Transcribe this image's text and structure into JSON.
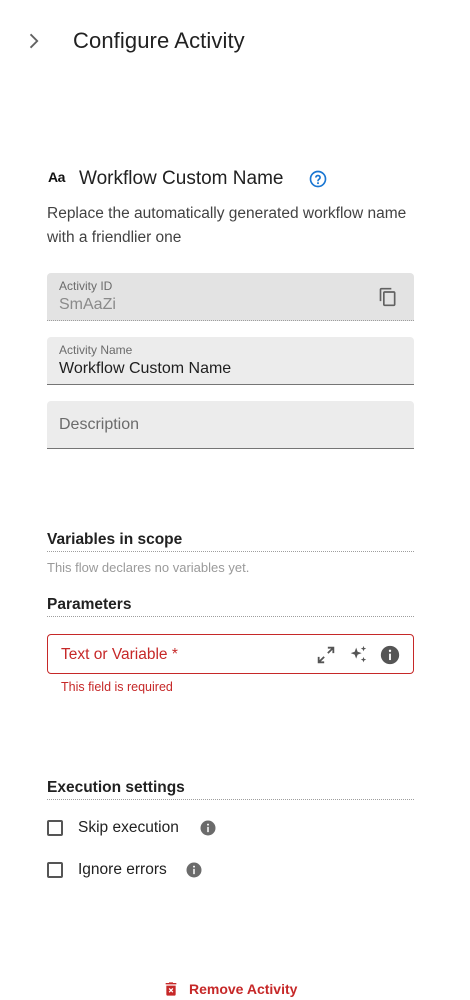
{
  "header": {
    "title": "Configure Activity",
    "back_icon": "chevron-right-icon"
  },
  "section": {
    "icon": "text-format-icon",
    "icon_text": "Aa",
    "title": "Workflow Custom Name",
    "help_icon": "help-circle-icon",
    "description": "Replace the automatically generated workflow name with a friendlier one"
  },
  "fields": {
    "activity_id": {
      "label": "Activity ID",
      "value": "SmAaZi",
      "copy_icon": "copy-icon",
      "disabled": true
    },
    "activity_name": {
      "label": "Activity Name",
      "value": "Workflow Custom Name"
    },
    "description": {
      "placeholder": "Description",
      "value": ""
    }
  },
  "variables": {
    "title": "Variables in scope",
    "empty_text": "This flow declares no variables yet."
  },
  "parameters": {
    "title": "Parameters",
    "text_field": {
      "placeholder": "Text or Variable *",
      "error": "This field is required",
      "icons": [
        "expand-icon",
        "sparkles-icon",
        "info-icon"
      ]
    }
  },
  "execution": {
    "title": "Execution settings",
    "options": [
      {
        "label": "Skip execution",
        "checked": false,
        "info_icon": "info-icon"
      },
      {
        "label": "Ignore errors",
        "checked": false,
        "info_icon": "info-icon"
      }
    ]
  },
  "footer": {
    "remove_label": "Remove Activity",
    "remove_icon": "trash-icon"
  },
  "colors": {
    "error": "#c62828",
    "accent": "#1976d2",
    "field_bg": "#ececec"
  }
}
